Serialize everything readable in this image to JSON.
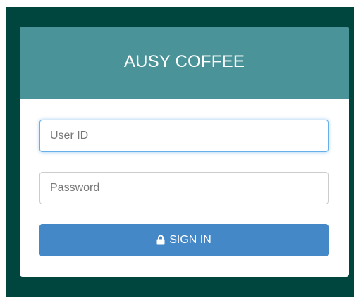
{
  "app": {
    "title": "AUSY COFFEE"
  },
  "login": {
    "user_id": {
      "placeholder": "User ID",
      "value": ""
    },
    "password": {
      "placeholder": "Password",
      "value": ""
    },
    "sign_in_label": "SIGN IN",
    "sign_in_icon": "lock-icon"
  },
  "colors": {
    "background": "#01453f",
    "header": "#4a9499",
    "button": "#4588c7",
    "focus_border": "#66afe9"
  }
}
